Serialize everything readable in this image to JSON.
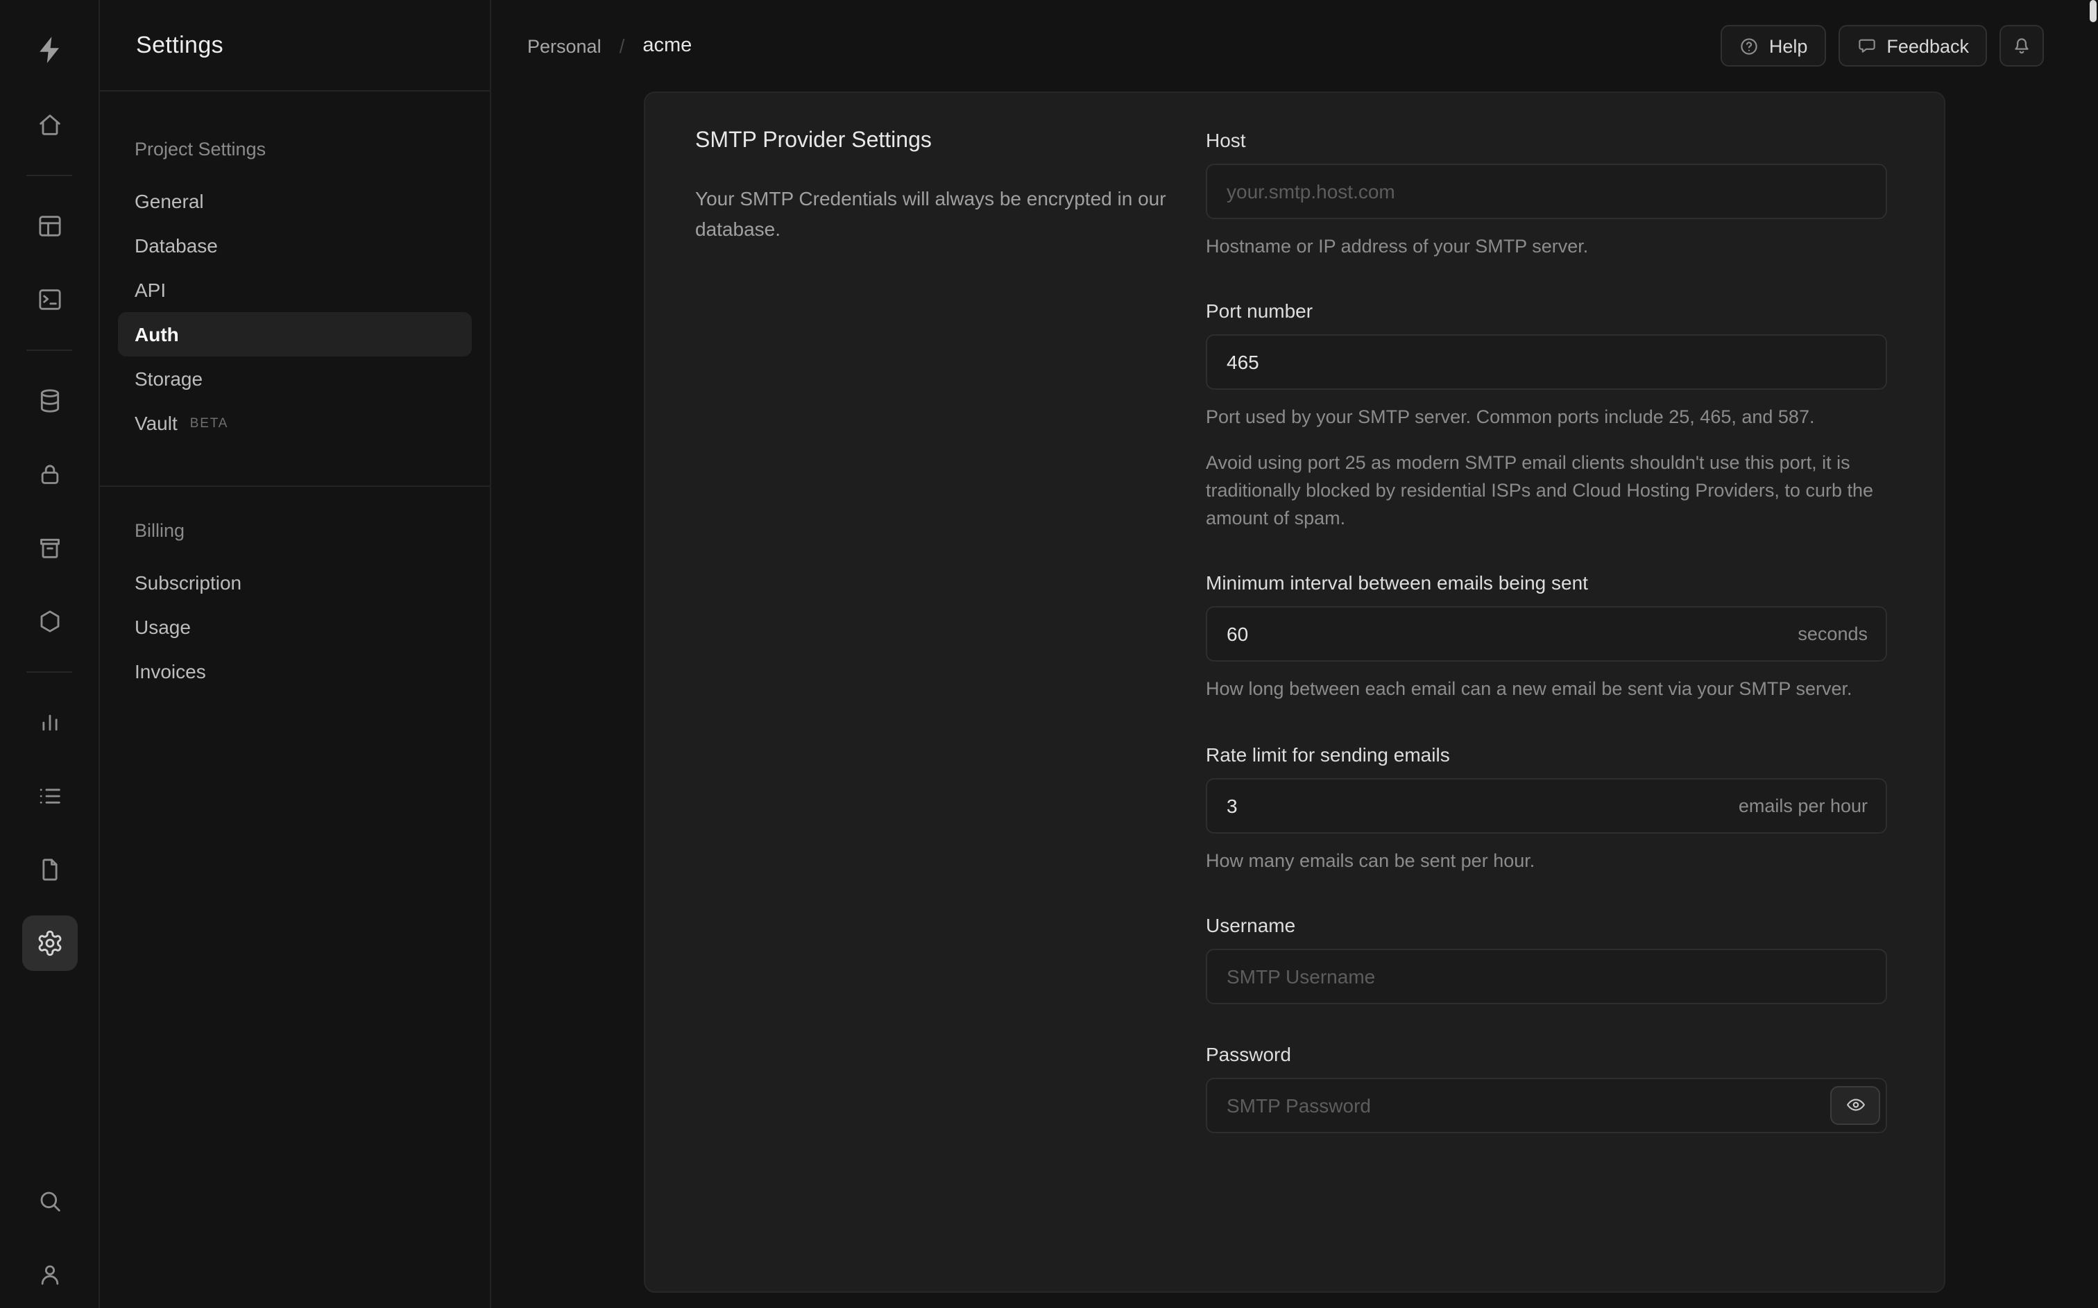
{
  "colors": {
    "page_background": "#131313",
    "panel_background": "#1e1e1e",
    "border": "#2e2e2e",
    "text_primary": "#e8e8e8",
    "text_muted": "#8c8c8c"
  },
  "rail": {
    "icons": [
      "supabase-logo",
      "home",
      "table-editor",
      "sql-editor",
      "database",
      "auth",
      "storage",
      "edge-functions",
      "reports",
      "logs",
      "docs",
      "settings",
      "search",
      "user"
    ],
    "active": "settings"
  },
  "sidebar": {
    "title": "Settings",
    "sections": [
      {
        "heading": "Project Settings",
        "items": [
          {
            "label": "General"
          },
          {
            "label": "Database"
          },
          {
            "label": "API"
          },
          {
            "label": "Auth",
            "active": true
          },
          {
            "label": "Storage"
          },
          {
            "label": "Vault",
            "badge": "BETA"
          }
        ]
      },
      {
        "heading": "Billing",
        "items": [
          {
            "label": "Subscription"
          },
          {
            "label": "Usage"
          },
          {
            "label": "Invoices"
          }
        ]
      }
    ]
  },
  "header": {
    "breadcrumb": {
      "org": "Personal",
      "separator": "/",
      "project": "acme"
    },
    "buttons": {
      "help": "Help",
      "feedback": "Feedback"
    }
  },
  "panel": {
    "title": "SMTP Provider Settings",
    "description": "Your SMTP Credentials will always be encrypted in our database.",
    "fields": {
      "host": {
        "label": "Host",
        "placeholder": "your.smtp.host.com",
        "help": "Hostname or IP address of your SMTP server."
      },
      "port": {
        "label": "Port number",
        "value": "465",
        "help": "Port used by your SMTP server. Common ports include 25, 465, and 587.",
        "note": "Avoid using port 25 as modern SMTP email clients shouldn't use this port, it is traditionally blocked by residential ISPs and Cloud Hosting Providers, to curb the amount of spam."
      },
      "interval": {
        "label": "Minimum interval between emails being sent",
        "value": "60",
        "suffix": "seconds",
        "help": "How long between each email can a new email be sent via your SMTP server."
      },
      "rate_limit": {
        "label": "Rate limit for sending emails",
        "value": "3",
        "suffix": "emails per hour",
        "help": "How many emails can be sent per hour."
      },
      "username": {
        "label": "Username",
        "placeholder": "SMTP Username"
      },
      "password": {
        "label": "Password",
        "placeholder": "SMTP Password"
      }
    }
  }
}
